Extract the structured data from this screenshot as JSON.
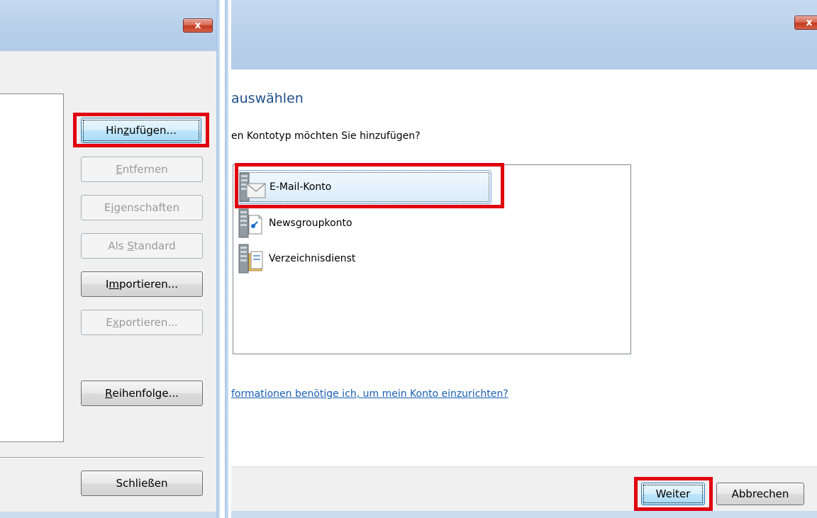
{
  "left_dialog": {
    "close_label": "x",
    "buttons": {
      "add": {
        "pre": "Hin",
        "ul": "z",
        "post": "ufügen..."
      },
      "remove": {
        "pre": "",
        "ul": "E",
        "post": "ntfernen"
      },
      "properties": {
        "pre": "E",
        "ul": "i",
        "post": "genschaften"
      },
      "set_default": {
        "pre": "Als ",
        "ul": "S",
        "post": "tandard"
      },
      "import": {
        "pre": "I",
        "ul": "m",
        "post": "portieren..."
      },
      "export": {
        "pre": "E",
        "ul": "x",
        "post": "portieren..."
      },
      "order": {
        "pre": "",
        "ul": "R",
        "post": "eihenfolge..."
      },
      "close": {
        "pre": "Schließen",
        "ul": "",
        "post": ""
      }
    }
  },
  "right_dialog": {
    "close_label": "x",
    "heading": "auswählen",
    "question": "en Kontotyp möchten Sie hinzufügen?",
    "account_types": [
      {
        "label": "E-Mail-Konto",
        "icon": "email-server-icon",
        "selected": true
      },
      {
        "label": "Newsgroupkonto",
        "icon": "newsgroup-server-icon",
        "selected": false
      },
      {
        "label": "Verzeichnisdienst",
        "icon": "directory-server-icon",
        "selected": false
      }
    ],
    "help_link": "formationen benötige ich, um mein Konto einzurichten?",
    "buttons": {
      "next": "Weiter",
      "cancel": "Abbrechen"
    }
  },
  "colors": {
    "highlight_box": "#e0000f",
    "titlebar": "#b7cfea",
    "link": "#1a5fb4",
    "heading": "#1e4e8a"
  }
}
